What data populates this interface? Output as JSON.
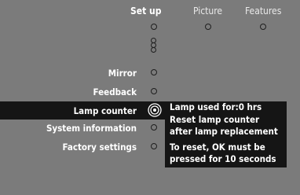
{
  "tabs": [
    {
      "label": "Set up",
      "active": true
    },
    {
      "label": "Picture",
      "active": false
    },
    {
      "label": "Features",
      "active": false
    }
  ],
  "menu": {
    "items": [
      {
        "label": "Mirror",
        "selected": false
      },
      {
        "label": "Feedback",
        "selected": false
      },
      {
        "label": "Lamp counter",
        "selected": true
      },
      {
        "label": "System information",
        "selected": false
      },
      {
        "label": "Factory settings",
        "selected": false
      }
    ]
  },
  "info": {
    "lines": [
      "Lamp used for:0 hrs",
      "Reset lamp counter",
      "after lamp replacement",
      "To reset, OK must be",
      "pressed for 10 seconds"
    ]
  },
  "colors": {
    "background": "#7b7b7b",
    "highlight": "#151515",
    "text": "#ffffff"
  }
}
